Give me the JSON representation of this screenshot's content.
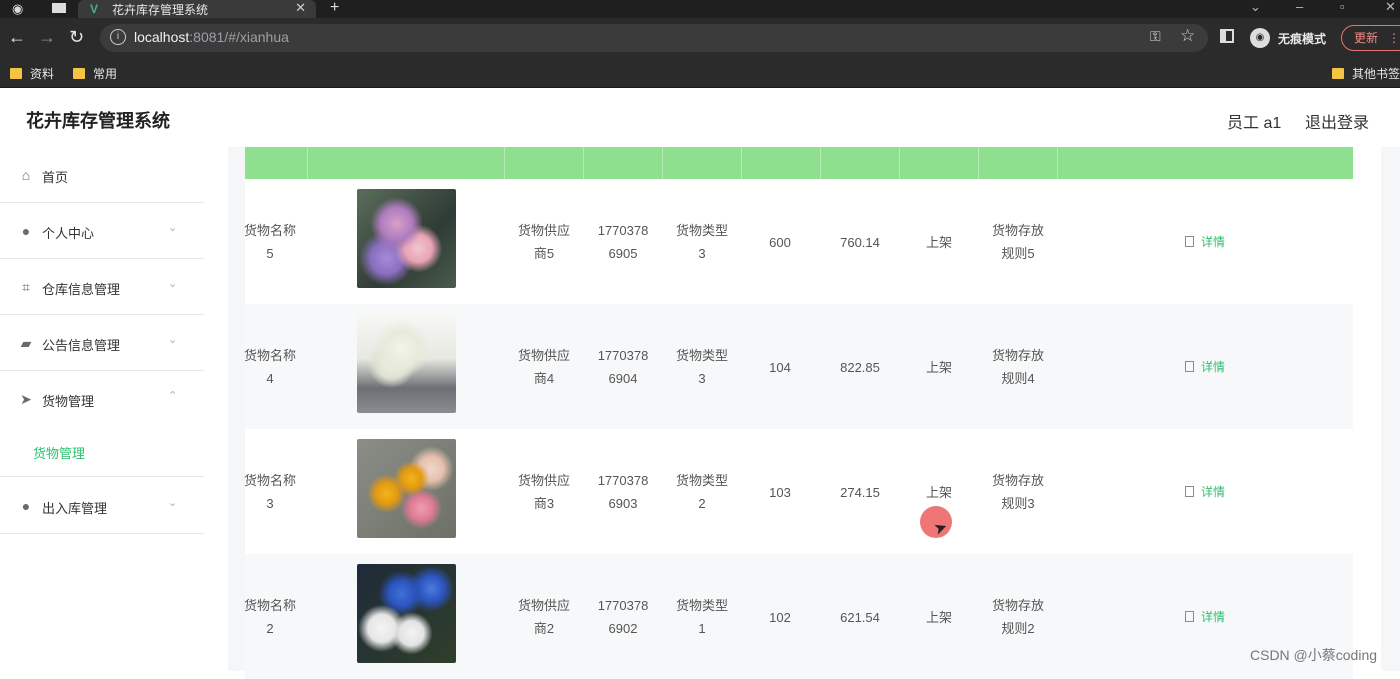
{
  "browser": {
    "tab_title": "花卉库存管理系统",
    "url_host": "localhost",
    "url_rest": ":8081/#/xianhua",
    "incognito_label": "无痕模式",
    "update_label": "更新",
    "bookmarks": [
      "资料",
      "常用",
      "其他书签"
    ]
  },
  "app": {
    "title": "花卉库存管理系统",
    "user_label": "员工 a1",
    "logout_label": "退出登录"
  },
  "sidebar": {
    "items": [
      {
        "label": "首页",
        "icon": "home-icon"
      },
      {
        "label": "个人中心",
        "icon": "user-icon"
      },
      {
        "label": "仓库信息管理",
        "icon": "crop-icon"
      },
      {
        "label": "公告信息管理",
        "icon": "megaphone-icon"
      },
      {
        "label": "货物管理",
        "icon": "send-icon"
      },
      {
        "label": "出入库管理",
        "icon": "user-icon"
      }
    ],
    "submenu": {
      "label": "货物管理"
    }
  },
  "table": {
    "detail_label": "详情",
    "rows": [
      {
        "name": "货物名称\n5",
        "supplier": "货物供应\n商5",
        "phone": "1770378\n6905",
        "type": "货物类型\n3",
        "qty": "600",
        "price": "760.14",
        "status": "上架",
        "rule": "货物存放\n规则5"
      },
      {
        "name": "货物名称\n4",
        "supplier": "货物供应\n商4",
        "phone": "1770378\n6904",
        "type": "货物类型\n3",
        "qty": "104",
        "price": "822.85",
        "status": "上架",
        "rule": "货物存放\n规则4"
      },
      {
        "name": "货物名称\n3",
        "supplier": "货物供应\n商3",
        "phone": "1770378\n6903",
        "type": "货物类型\n2",
        "qty": "103",
        "price": "274.15",
        "status": "上架",
        "rule": "货物存放\n规则3"
      },
      {
        "name": "货物名称\n2",
        "supplier": "货物供应\n商2",
        "phone": "1770378\n6902",
        "type": "货物类型\n1",
        "qty": "102",
        "price": "621.54",
        "status": "上架",
        "rule": "货物存放\n规则2"
      }
    ]
  },
  "watermark": "CSDN @小蔡coding"
}
